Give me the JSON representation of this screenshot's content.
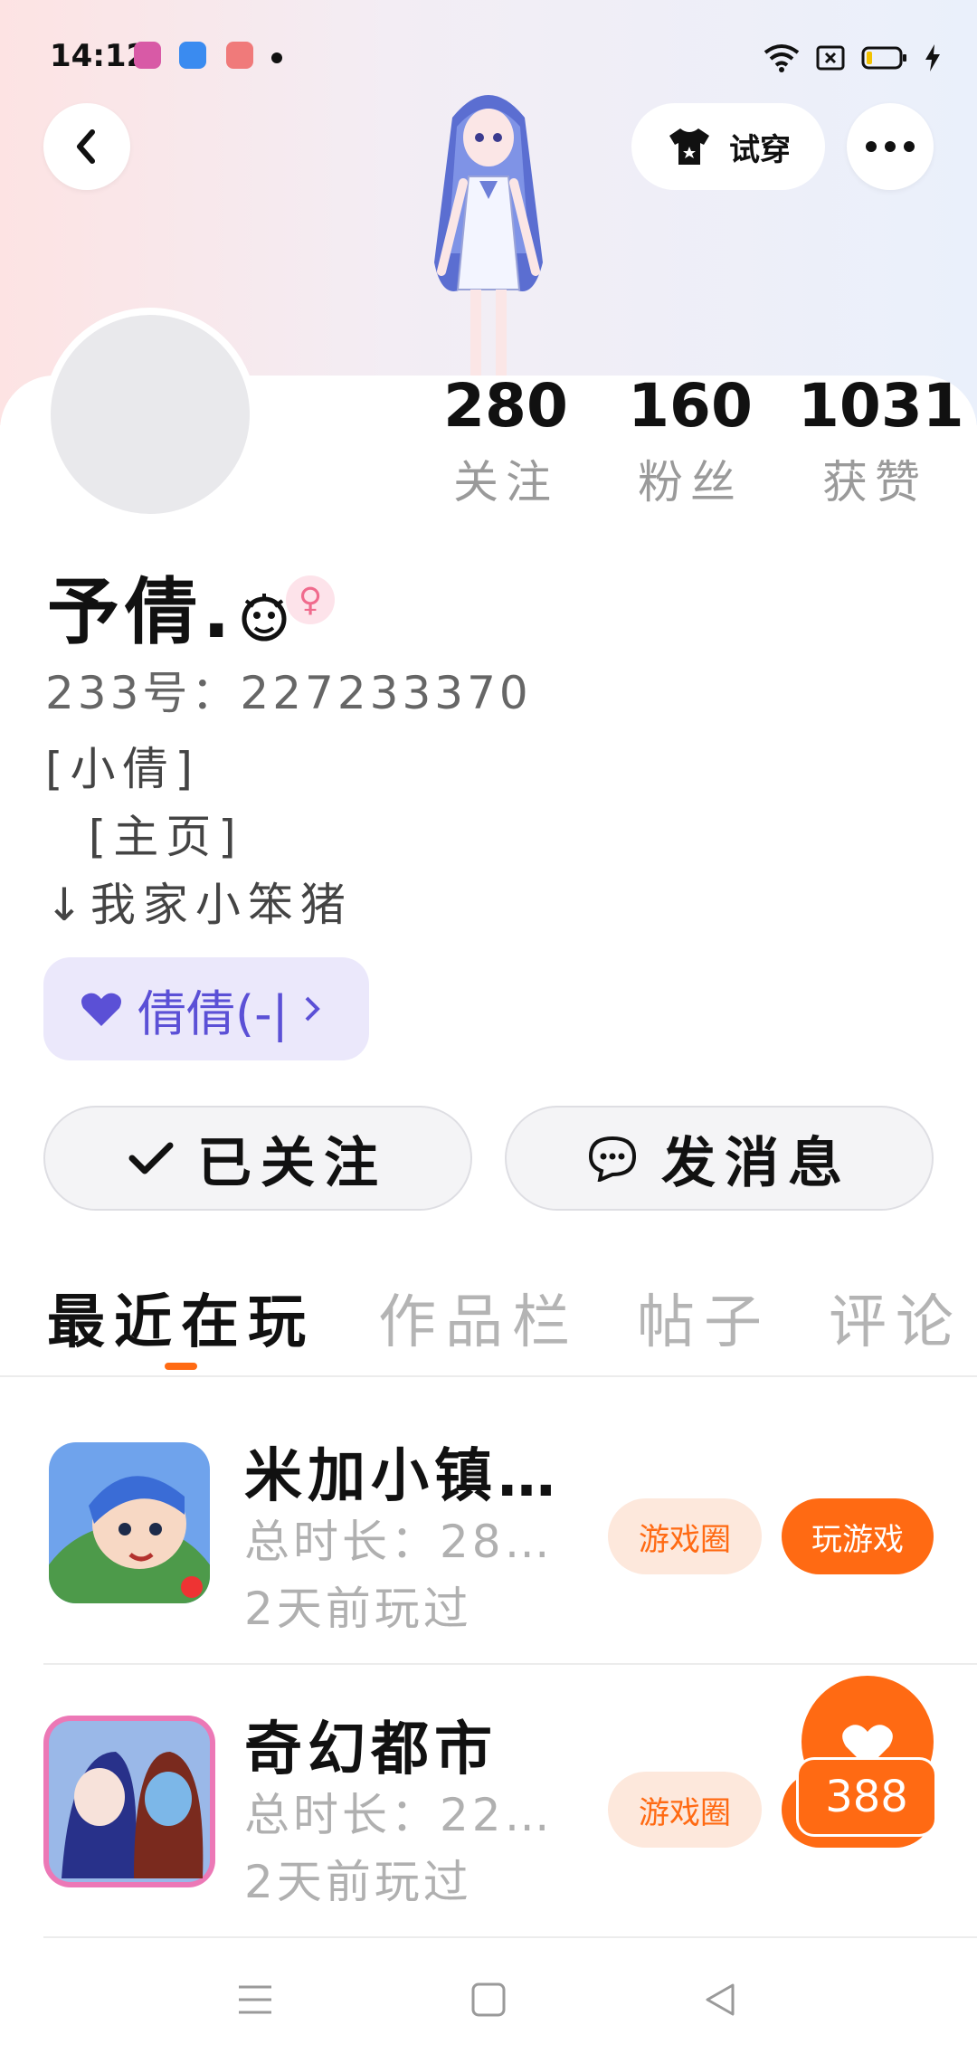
{
  "status_bar": {
    "time": "14:12"
  },
  "header": {
    "tryon_label": "试穿"
  },
  "profile": {
    "stats": [
      {
        "value": "280",
        "label": "关注"
      },
      {
        "value": "160",
        "label": "粉丝"
      },
      {
        "value": "1031",
        "label": "获赞"
      }
    ],
    "name": "予倩.",
    "gender_symbol": "♀",
    "account_id": "233号：227233370",
    "bio_lines": [
      "[小倩]",
      "  [主页]",
      "↓我家小笨猪"
    ],
    "fan_group_label": "倩倩(-|",
    "follow_button": "已关注",
    "message_button": "发消息"
  },
  "tabs": [
    "最近在玩",
    "作品栏",
    "帖子",
    "评论"
  ],
  "games": [
    {
      "title": "米加小镇…",
      "playtime": "总时长：28…",
      "last_played": "2天前玩过",
      "circle_label": "游戏圈",
      "play_label": "玩游戏"
    },
    {
      "title": "奇幻都市",
      "playtime": "总时长：22…",
      "last_played": "2天前玩过",
      "circle_label": "游戏圈",
      "play_label": ""
    }
  ],
  "like_badge": {
    "count": "388"
  },
  "colors": {
    "accent": "#ff6a13",
    "fan_chip": "#5b50d6",
    "gender": "#f06b8d"
  }
}
